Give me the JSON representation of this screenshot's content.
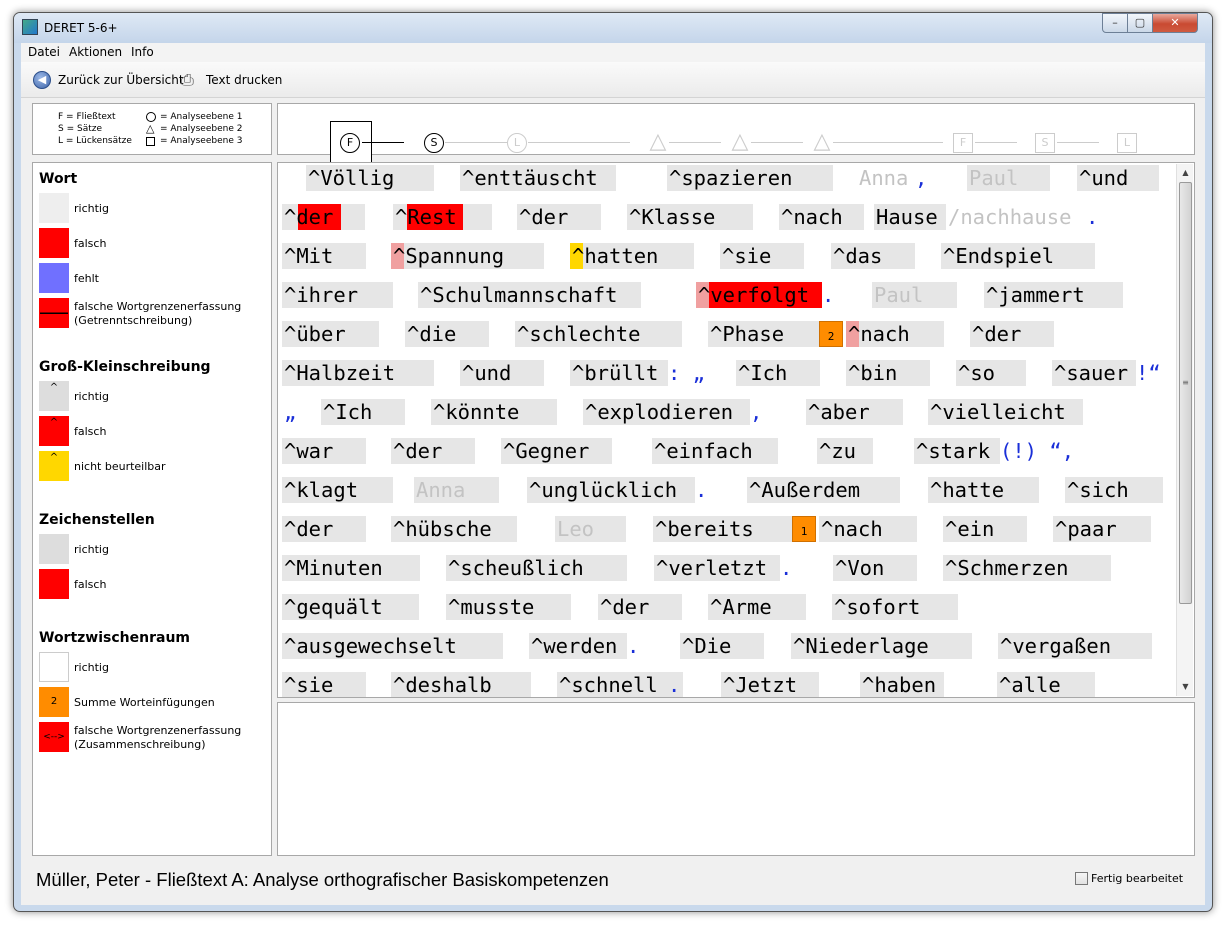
{
  "window": {
    "title": "DERET 5-6+",
    "minimize": "–",
    "maximize": "▢",
    "close": "✕"
  },
  "menu": [
    "Datei",
    "Aktionen",
    "Info"
  ],
  "toolbar": {
    "back_label": "Zurück zur Übersicht",
    "print_label": "Text drucken"
  },
  "key": {
    "l1": "F = Fließtext",
    "l2": "S = Sätze",
    "l3": "L = Lückensätze",
    "r1": "= Analyseebene 1",
    "r2": "= Analyseebene 2",
    "r3": "= Analyseebene 3"
  },
  "levels": [
    "F",
    "S",
    "L",
    "F",
    "S",
    "L",
    "F",
    "S",
    "L"
  ],
  "legend": {
    "wort": {
      "title": "Wort",
      "richtig": "richtig",
      "falsch": "falsch",
      "fehlt": "fehlt",
      "falsche_wg1": "falsche Wortgrenzenerfassung",
      "falsche_wg2": "(Getrenntschreibung)"
    },
    "gross": {
      "title": "Groß-Kleinschreibung",
      "richtig": "richtig",
      "falsch": "falsch",
      "nicht": "nicht beurteilbar",
      "caret": "^"
    },
    "zeichen": {
      "title": "Zeichenstellen",
      "richtig": "richtig",
      "falsch": "falsch"
    },
    "zwischen": {
      "title": "Wortzwischenraum",
      "richtig": "richtig",
      "summe_badge": "2",
      "summe": "Summe Worteinfügungen",
      "zusammen_badge": "<-->",
      "zusammen1": "falsche Wortgrenzenerfassung",
      "zusammen2": "(Zusammenschreibung)"
    }
  },
  "text": {
    "lines": [
      [
        "^Völlig",
        "^enttäuscht",
        "^spazieren",
        "Anna",
        ",",
        "Paul",
        "^und"
      ],
      [
        "^der",
        "^Rest",
        "^der",
        "^Klasse",
        "^nach",
        "Hause",
        "/nachhause",
        "."
      ],
      [
        "^Mit",
        "^Spannung",
        "^hatten",
        "^sie",
        "^das",
        "^Endspiel"
      ],
      [
        "^ihrer",
        "^Schulmannschaft",
        "^verfolgt",
        ".",
        "Paul",
        "^jammert"
      ],
      [
        "^über",
        "^die",
        "^schlechte",
        "^Phase",
        "2",
        "^nach",
        "^der"
      ],
      [
        "^Halbzeit",
        "^und",
        "^brüllt",
        ": „",
        "^Ich",
        "^bin",
        "^so",
        "^sauer",
        "!“"
      ],
      [
        "„",
        "^Ich",
        "^könnte",
        "^explodieren",
        ",",
        "^aber",
        "^vielleicht"
      ],
      [
        "^war",
        "^der",
        "^Gegner",
        "^einfach",
        "^zu",
        "^stark",
        "(!) “,"
      ],
      [
        "^klagt",
        "Anna",
        "^unglücklich",
        ".",
        "^Außerdem",
        "^hatte",
        "^sich"
      ],
      [
        "^der",
        "^hübsche",
        "Leo",
        "^bereits",
        "1",
        "^nach",
        "^ein",
        "^paar"
      ],
      [
        "^Minuten",
        "^scheußlich",
        "^verletzt",
        ".",
        "^Von",
        "^Schmerzen"
      ],
      [
        "^gequält",
        "^musste",
        "^der",
        "^Arme",
        "^sofort"
      ],
      [
        "^ausgewechselt",
        "^werden",
        ".",
        "^Die",
        "^Niederlage",
        "^vergaßen"
      ],
      [
        "^sie",
        "^deshalb",
        "^schnell",
        ".",
        "^Jetzt",
        "^haben",
        "^alle"
      ]
    ]
  },
  "status": {
    "text": "Müller, Peter -  Fließtext A:  Analyse orthografischer Basiskompetenzen",
    "done_label": "Fertig bearbeitet"
  },
  "colors": {
    "error": "#ff0000",
    "missing": "#7070ff",
    "unknown": "#ffd700",
    "badge": "#ff8c00",
    "punct": "#1a2fd8",
    "word_bg": "#e6e6e6"
  }
}
